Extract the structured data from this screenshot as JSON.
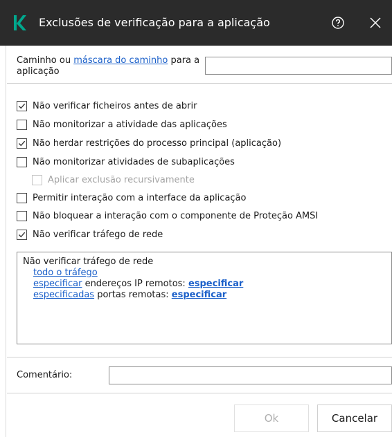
{
  "dialog": {
    "title": "Exclusões de verificação para a aplicação",
    "brand_color": "#00a88e",
    "icons": {
      "logo": "kaspersky-k-logo",
      "help": "help-icon",
      "close": "close-icon"
    }
  },
  "path": {
    "label_prefix": "Caminho ou ",
    "label_link": "máscara do caminho",
    "label_suffix": " para a aplicação",
    "value": ""
  },
  "options": [
    {
      "label": "Não verificar ficheiros antes de abrir",
      "checked": true,
      "disabled": false
    },
    {
      "label": "Não monitorizar a atividade das aplicações",
      "checked": false,
      "disabled": false
    },
    {
      "label": "Não herdar restrições do processo principal (aplicação)",
      "checked": true,
      "disabled": false
    },
    {
      "label": "Não monitorizar atividades de subaplicações",
      "checked": false,
      "disabled": false
    },
    {
      "label": "Aplicar exclusão recursivamente",
      "checked": false,
      "disabled": true
    },
    {
      "label": "Permitir interação com a interface da aplicação",
      "checked": false,
      "disabled": false
    },
    {
      "label": "Não bloquear a interação com o componente de Proteção AMSI",
      "checked": false,
      "disabled": false
    },
    {
      "label": "Não verificar tráfego de rede",
      "checked": true,
      "disabled": false
    }
  ],
  "description": {
    "heading": "Não verificar tráfego de rede",
    "traffic_link": "todo o tráfego",
    "ip_link": "especificar",
    "ip_text": " endereços IP remotos: ",
    "ip_value_link": "especificar",
    "ports_link": "especificadas",
    "ports_text": " portas remotas: ",
    "ports_value_link": "especificar"
  },
  "comment": {
    "label": "Comentário:",
    "value": ""
  },
  "buttons": {
    "ok": "Ok",
    "cancel": "Cancelar",
    "ok_enabled": false
  }
}
